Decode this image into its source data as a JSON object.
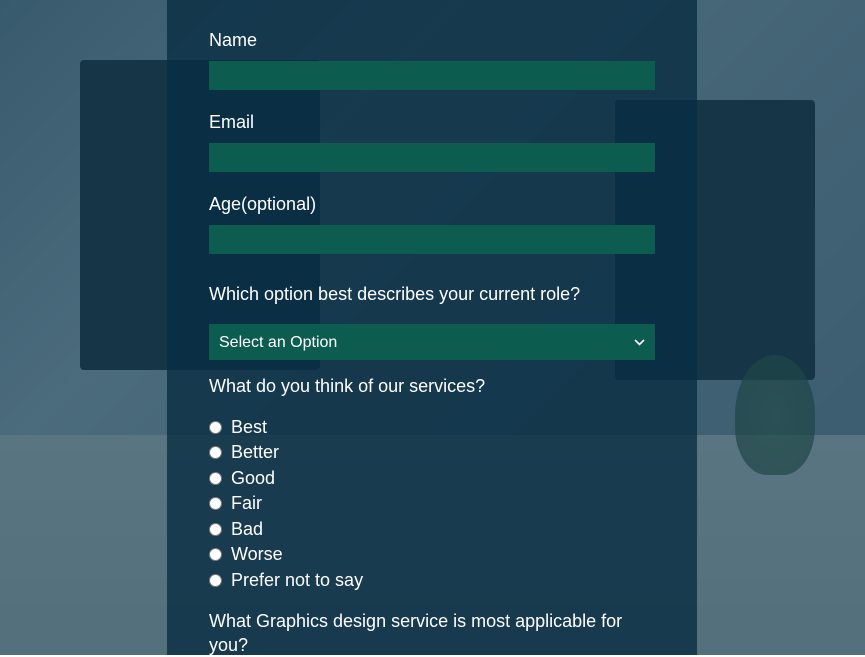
{
  "form": {
    "name": {
      "label": "Name",
      "value": ""
    },
    "email": {
      "label": "Email",
      "value": ""
    },
    "age": {
      "label": "Age(optional)",
      "value": ""
    },
    "role": {
      "label": "Which option best describes your current role?",
      "selected": "Select an Option"
    },
    "services_rating": {
      "label": "What do you think of our services?",
      "options": {
        "best": "Best",
        "better": "Better",
        "good": "Good",
        "fair": "Fair",
        "bad": "Bad",
        "worse": "Worse",
        "prefer_not": "Prefer not to say"
      }
    },
    "graphics_service": {
      "label": "What Graphics design service is most applicable for you?"
    }
  },
  "colors": {
    "input_bg": "#0d5c50",
    "panel_bg": "rgba(8, 44, 65, 0.78)",
    "overlay": "rgba(12, 55, 77, 0.65)"
  }
}
